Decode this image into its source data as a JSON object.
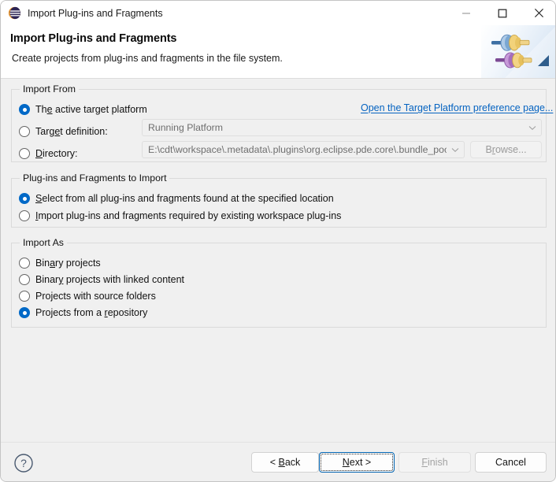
{
  "window": {
    "title": "Import Plug-ins and Fragments",
    "icon": "eclipse-icon",
    "controls": {
      "minimize": "minimize-icon",
      "maximize": "maximize-icon",
      "close": "close-icon"
    }
  },
  "header": {
    "title": "Import Plug-ins and Fragments",
    "description": "Create projects from plug-ins and fragments in the file system.",
    "banner_icon": "plug-connector-icon"
  },
  "import_from": {
    "group_label": "Import From",
    "link_label": "Open the Target Platform preference page...",
    "options": [
      {
        "label": "The active target platform",
        "mnemonic_index": 5,
        "selected": true
      },
      {
        "label": "Target definition:",
        "mnemonic_index": 4,
        "selected": false
      },
      {
        "label": "Directory:",
        "mnemonic_index": 0,
        "selected": false
      }
    ],
    "target_definition_value": "Running Platform",
    "directory_value": "E:\\cdt\\workspace\\.metadata\\.plugins\\org.eclipse.pde.core\\.bundle_pool",
    "browse_label": "Browse...",
    "browse_mnemonic_index": 1
  },
  "plugins_to_import": {
    "group_label": "Plug-ins and Fragments to Import",
    "options": [
      {
        "label": "Select from all plug-ins and fragments found at the specified location",
        "mnemonic_index": 0,
        "selected": true
      },
      {
        "label": "Import plug-ins and fragments required by existing workspace plug-ins",
        "mnemonic_index": 0,
        "selected": false
      }
    ]
  },
  "import_as": {
    "group_label": "Import As",
    "options": [
      {
        "label": "Binary projects",
        "mnemonic_index": 3,
        "selected": false
      },
      {
        "label": "Binary projects with linked content",
        "mnemonic_index": 4,
        "selected": false
      },
      {
        "label": "Projects with source folders",
        "mnemonic_index": -1,
        "selected": false
      },
      {
        "label": "Projects from a repository",
        "mnemonic_index": 15,
        "selected": true
      }
    ]
  },
  "footer": {
    "help_icon": "help-question-icon",
    "buttons": [
      {
        "label": "< Back",
        "mnemonic_index": 2,
        "state": "enabled",
        "focused": false
      },
      {
        "label": "Next >",
        "mnemonic_index": 0,
        "state": "enabled",
        "focused": true
      },
      {
        "label": "Finish",
        "mnemonic_index": 1,
        "state": "disabled",
        "focused": false
      },
      {
        "label": "Cancel",
        "mnemonic_index": -1,
        "state": "enabled",
        "focused": false
      }
    ]
  },
  "colors": {
    "accent": "#0069c7",
    "link": "#0563c1",
    "dialog_bg": "#f0f0f0",
    "header_bg": "#ffffff",
    "focus_border": "#0063b1"
  }
}
